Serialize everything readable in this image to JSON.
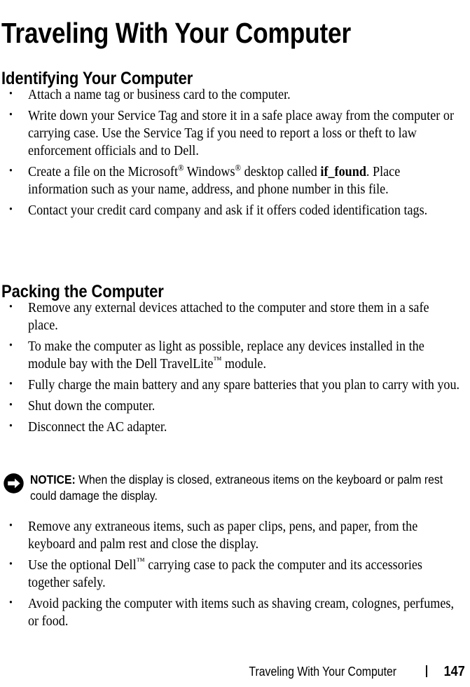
{
  "document": {
    "page_title": "Traveling With Your Computer"
  },
  "sections": [
    {
      "heading": "Identifying Your Computer",
      "bullets": [
        {
          "text": "Attach a name tag or business card to the computer."
        },
        {
          "text": "Write down your Service Tag and store it in a safe place away from the computer or carrying case. Use the Service Tag if you need to report a loss or theft to law enforcement officials and to Dell."
        },
        {
          "rich": true,
          "parts": [
            {
              "t": "text",
              "v": "Create a file on the Microsoft"
            },
            {
              "t": "sup",
              "v": "®"
            },
            {
              "t": "text",
              "v": " Windows"
            },
            {
              "t": "sup",
              "v": "®"
            },
            {
              "t": "text",
              "v": " desktop called "
            },
            {
              "t": "bold",
              "v": "if_found"
            },
            {
              "t": "text",
              "v": ". Place information such as your name, address, and phone number in this file."
            }
          ]
        },
        {
          "text": "Contact your credit card company and ask if it offers coded identification tags."
        }
      ]
    },
    {
      "heading": "Packing the Computer",
      "bullets": [
        {
          "text": "Remove any external devices attached to the computer and store them in a safe place."
        },
        {
          "rich": true,
          "parts": [
            {
              "t": "text",
              "v": "To make the computer as light as possible, replace any devices installed in the module bay with the Dell TravelLite"
            },
            {
              "t": "tm",
              "v": "™"
            },
            {
              "t": "text",
              "v": " module."
            }
          ]
        },
        {
          "text": "Fully charge the main battery and any spare batteries that you plan to carry with you."
        },
        {
          "text": "Shut down the computer."
        },
        {
          "text": "Disconnect the AC adapter."
        }
      ],
      "bullets_after_notice": [
        {
          "text": "Remove any extraneous items, such as paper clips, pens, and paper, from the keyboard and palm rest and close the display."
        },
        {
          "rich": true,
          "parts": [
            {
              "t": "text",
              "v": "Use the optional Dell"
            },
            {
              "t": "tm",
              "v": "™"
            },
            {
              "t": "text",
              "v": " carrying case to pack the computer and its accessories together safely."
            }
          ]
        },
        {
          "text": "Avoid packing the computer with items such as shaving cream, colognes, perfumes, or food."
        }
      ]
    }
  ],
  "notice": {
    "icon": "notice-arrow-icon",
    "label": "NOTICE:",
    "text": "When the display is closed, extraneous items on the keyboard or palm rest could damage the display."
  },
  "footer": {
    "title": "Traveling With Your Computer",
    "separator": "|",
    "page_number": "147"
  },
  "colors": {
    "text": "#000000",
    "background": "#ffffff",
    "notice_icon": "#000000"
  }
}
